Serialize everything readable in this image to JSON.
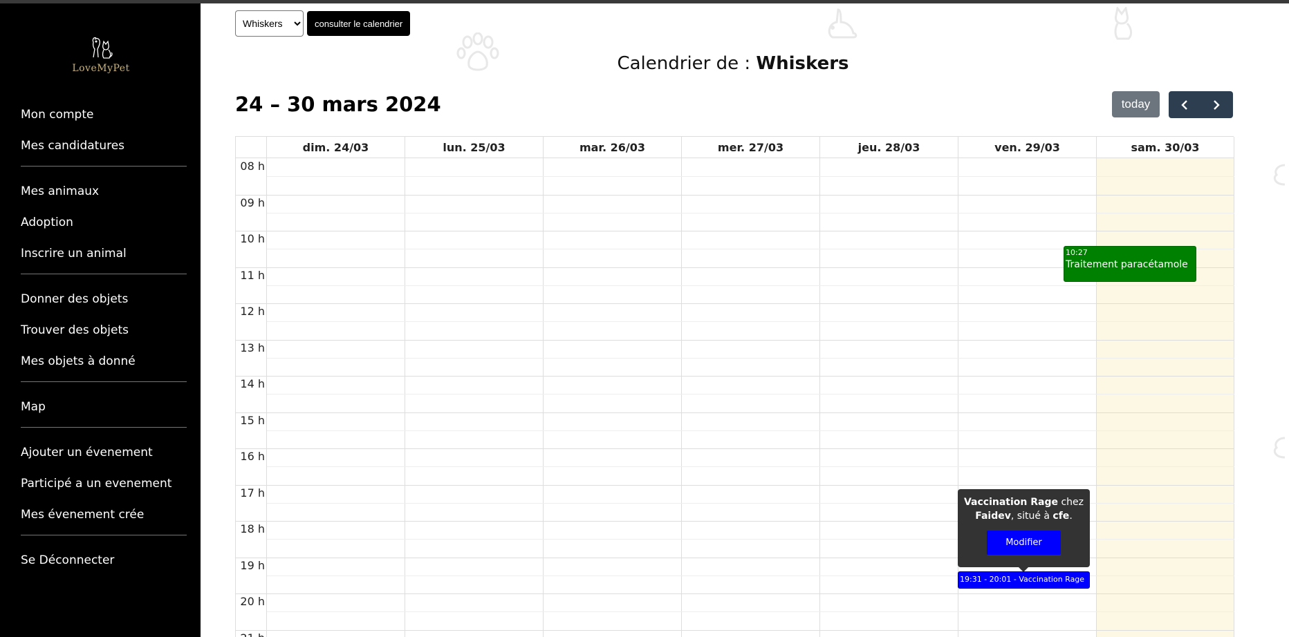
{
  "sidebar": {
    "logo_text": "LoveMyPet",
    "groups": [
      [
        "Mon compte",
        "Mes candidatures"
      ],
      [
        "Mes animaux",
        "Adoption",
        "Inscrire un animal"
      ],
      [
        "Donner des objets",
        "Trouver des objets",
        "Mes objets à donné"
      ],
      [
        "Map"
      ],
      [
        "Ajouter un évenement",
        "Participé a un evenement",
        "Mes évenement crée"
      ],
      [
        "Se Déconnecter"
      ]
    ]
  },
  "controls": {
    "animal_select_value": "Whiskers",
    "consult_label": "consulter le calendrier"
  },
  "calendar": {
    "title_prefix": "Calendrier de : ",
    "title_name": "Whiskers",
    "range": "24 – 30 mars 2024",
    "today_label": "today",
    "prev_icon": "chevron-left-icon",
    "next_icon": "chevron-right-icon",
    "days": [
      "dim. 24/03",
      "lun. 25/03",
      "mar. 26/03",
      "mer. 27/03",
      "jeu. 28/03",
      "ven. 29/03",
      "sam. 30/03"
    ],
    "hours": [
      "08 h",
      "09 h",
      "10 h",
      "11 h",
      "12 h",
      "13 h",
      "14 h",
      "15 h",
      "16 h",
      "17 h",
      "18 h",
      "19 h",
      "20 h",
      "21 h"
    ]
  },
  "events": {
    "green": {
      "time": "10:27",
      "title": "Traitement paracétamole",
      "color": "#008000"
    },
    "blue": {
      "text": "19:31 - 20:01 - Vaccination Rage",
      "color": "#0000ff"
    }
  },
  "popup": {
    "event_name": "Vaccination Rage",
    "chez": " chez",
    "vet": "Faidev",
    "situe": ", situé à ",
    "place": "cfe",
    "period": ".",
    "button": "Modifier"
  },
  "colors": {
    "today_highlight": "#fcf8e3",
    "nav_button": "#2c3e50",
    "today_button": "#6c757d"
  }
}
